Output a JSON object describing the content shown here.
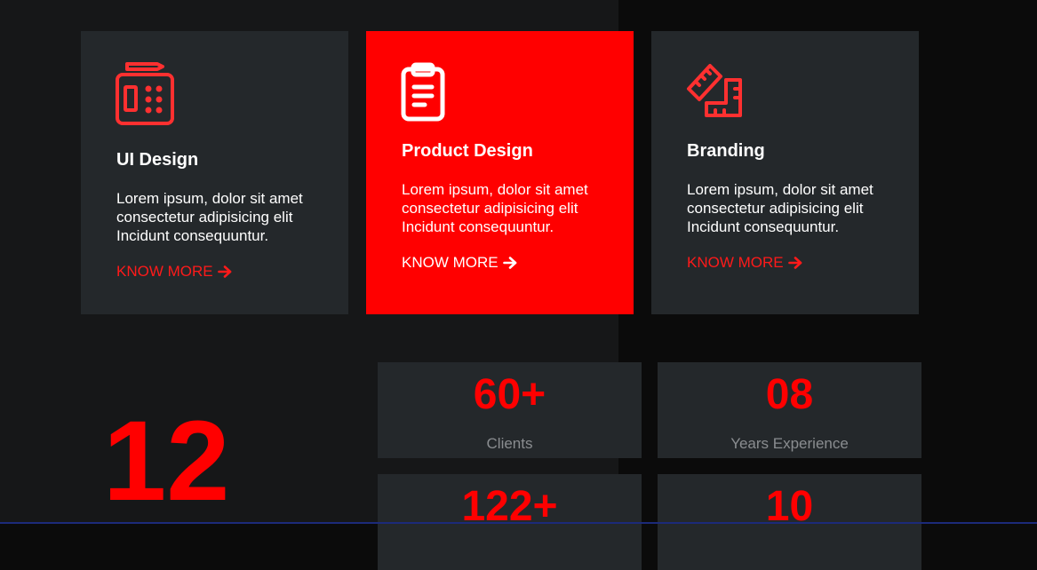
{
  "colors": {
    "accent": "#ff0000",
    "card_bg": "#24282b",
    "panel_bg": "#161718",
    "page_bg": "#0b0b0b",
    "stat_label": "#8a8d90"
  },
  "services": [
    {
      "icon": "calculator-pencil-icon",
      "title": "UI Design",
      "description": "Lorem ipsum, dolor sit amet consectetur adipisicing elit Incidunt consequuntur.",
      "link_label": "KNOW MORE"
    },
    {
      "icon": "clipboard-icon",
      "title": "Product Design",
      "description": "Lorem ipsum, dolor sit amet consectetur adipisicing elit Incidunt consequuntur.",
      "link_label": "KNOW MORE"
    },
    {
      "icon": "ruler-icon",
      "title": "Branding",
      "description": "Lorem ipsum, dolor sit amet consectetur adipisicing elit Incidunt consequuntur.",
      "link_label": "KNOW MORE"
    }
  ],
  "big_number": "12",
  "stats": [
    {
      "value": "60+",
      "label": "Clients"
    },
    {
      "value": "08",
      "label": "Years Experience"
    },
    {
      "value": "122+",
      "label": ""
    },
    {
      "value": "10",
      "label": ""
    }
  ]
}
